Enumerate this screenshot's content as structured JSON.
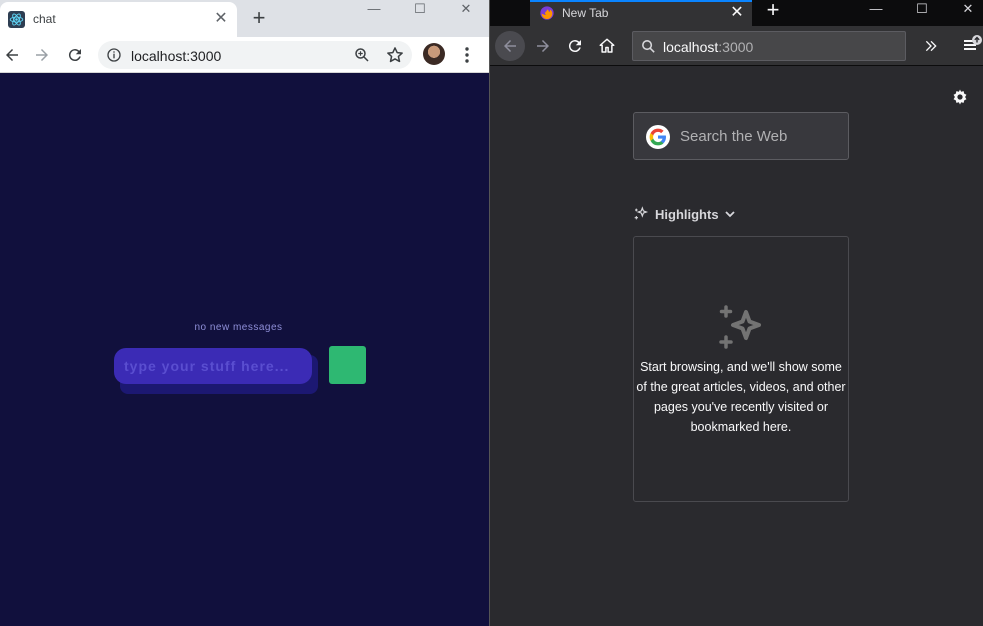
{
  "chrome": {
    "tab": {
      "title": "chat",
      "icon": "react-icon"
    },
    "url": "localhost:3000",
    "chat": {
      "status": "no new messages",
      "input_placeholder": "type your stuff here...",
      "send_color": "#2eb872"
    },
    "colors": {
      "page_bg": "#11103d",
      "input_bg": "#3b2bb5"
    }
  },
  "firefox": {
    "tab": {
      "title": "New Tab",
      "icon": "firefox-icon"
    },
    "url": {
      "host": "localhost",
      "port": ":3000"
    },
    "newtab": {
      "search_placeholder": "Search the Web",
      "highlights_label": "Highlights",
      "highlights_message": "Start browsing, and we'll show some of the great articles, videos, and other pages you've recently visited or bookmarked here."
    },
    "colors": {
      "page_bg": "#2a2a2e",
      "accent": "#0a84ff"
    }
  }
}
